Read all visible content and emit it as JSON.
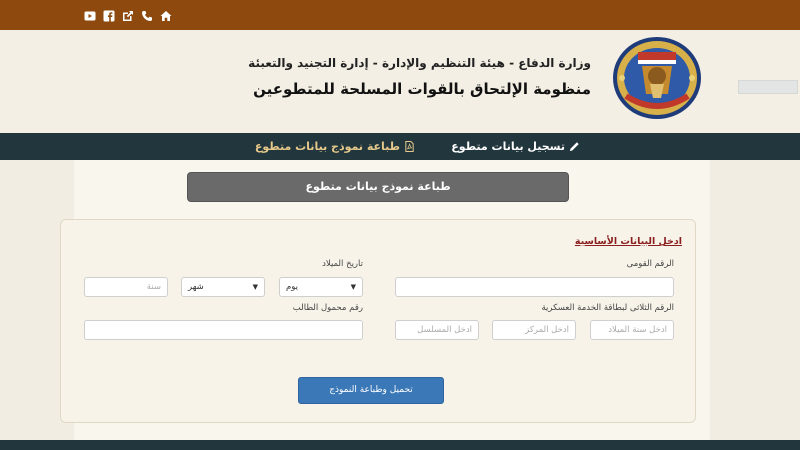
{
  "topbar": {
    "icons": [
      "home-icon",
      "phone-icon",
      "external-link-icon",
      "facebook-icon",
      "youtube-icon"
    ]
  },
  "header": {
    "ministry_line": "وزارة الدفاع - هيئة التنظيم والإدارة - إدارة التجنيد والتعبئة",
    "system_title": "منظومة الإلتحاق بالقوات المسلحة للمتطوعين"
  },
  "nav": {
    "register_label": "تسجيل بيانات متطوع",
    "print_label": "طباعة نموذج بيانات متطوع"
  },
  "banner": {
    "title": "طباعة نموذج بيانات متطوع"
  },
  "form": {
    "section_title": "ادخل البيانات الأساسية",
    "national_id_label": "الرقم القومى",
    "birthdate_label": "تاريخ الميلاد",
    "day_select": "يوم",
    "month_select": "شهر",
    "year_placeholder": "سنة",
    "military_card_label": "الرقم الثلاثى لبطاقة الخدمة العسكرية",
    "birth_year_placeholder": "ادخل سنة الميلاد",
    "center_placeholder": "ادخل المركز",
    "serial_placeholder": "ادخل المسلسل",
    "mobile_label": "رقم محمول الطالب",
    "submit_label": "تحميل وطباعة النموذج"
  },
  "colors": {
    "topbar": "#8e4a0e",
    "navbar": "#21363d",
    "nav_accent": "#e7c98b",
    "section_title": "#8a1d1d",
    "primary_button": "#3b78b8"
  }
}
